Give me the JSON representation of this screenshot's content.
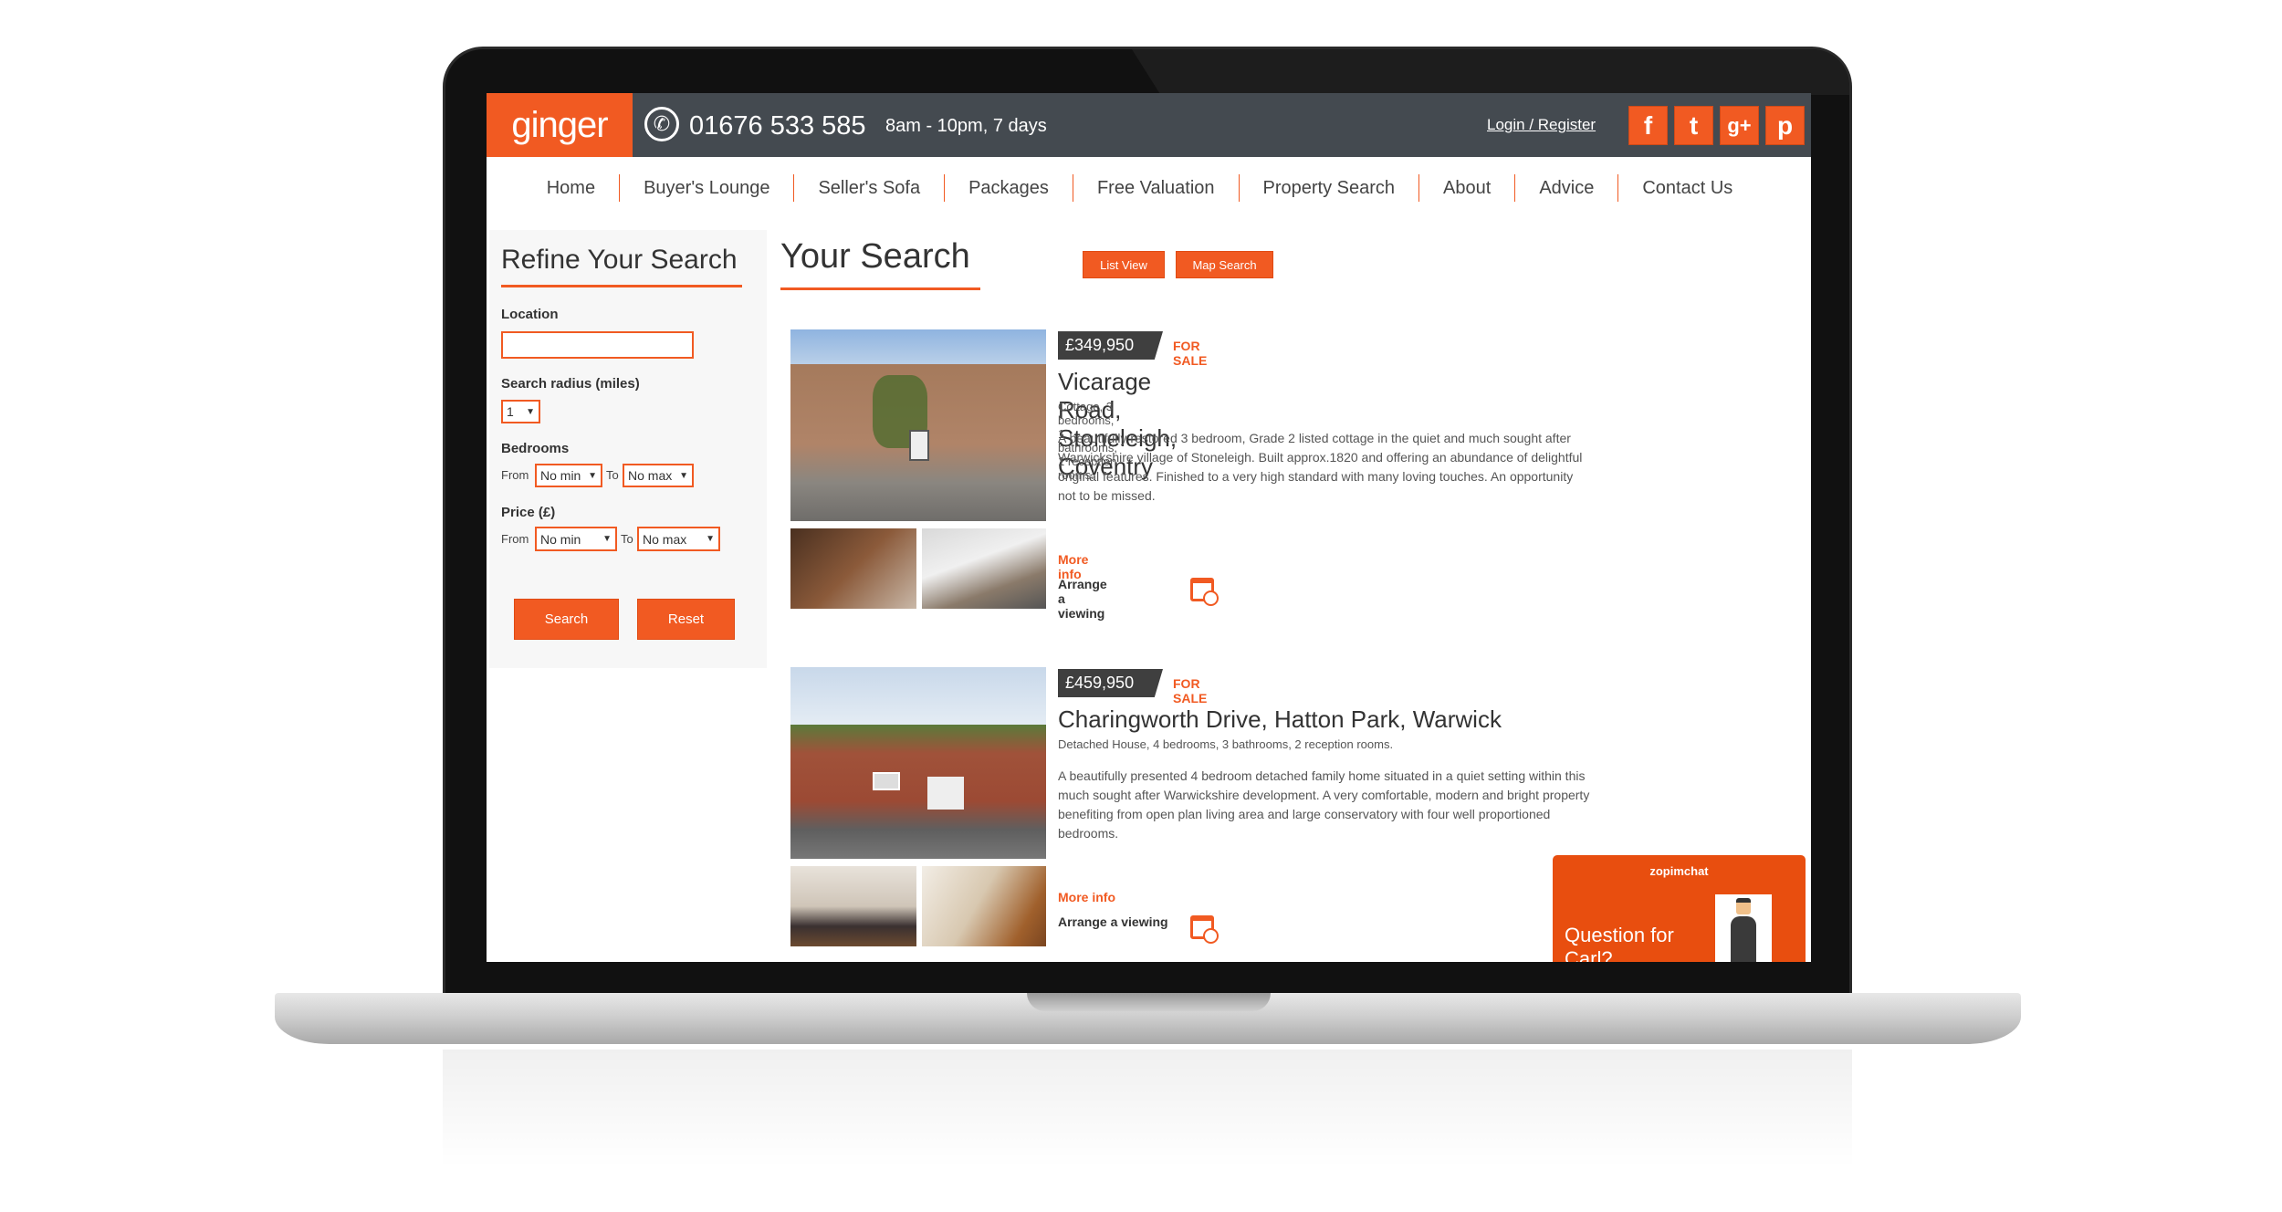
{
  "colors": {
    "accent": "#f15a22",
    "header_bg": "#444a50",
    "price_tag": "#3f3f3f",
    "chat": "#e84e0f"
  },
  "header": {
    "logo": "ginger",
    "phone_icon": "phone-icon",
    "phone": "01676 533 585",
    "hours": "8am - 10pm, 7 days",
    "login": "Login / Register",
    "social": [
      {
        "icon": "facebook-icon",
        "glyph": "f"
      },
      {
        "icon": "twitter-icon",
        "glyph": "t"
      },
      {
        "icon": "google-plus-icon",
        "glyph": "g+"
      },
      {
        "icon": "pinterest-icon",
        "glyph": "p"
      }
    ]
  },
  "nav": [
    "Home",
    "Buyer's Lounge",
    "Seller's Sofa",
    "Packages",
    "Free Valuation",
    "Property Search",
    "About",
    "Advice",
    "Contact Us"
  ],
  "sidebar": {
    "title": "Refine Your Search",
    "location_label": "Location",
    "location_value": "",
    "radius_label": "Search radius (miles)",
    "radius_value": "1",
    "bedrooms_label": "Bedrooms",
    "from": "From",
    "to": "To",
    "bed_min": "No min",
    "bed_max": "No max",
    "price_label": "Price (£)",
    "price_min": "No min",
    "price_max": "No max",
    "search": "Search",
    "reset": "Reset"
  },
  "main": {
    "title": "Your Search",
    "list_view": "List View",
    "map_search": "Map Search"
  },
  "listings": [
    {
      "price": "£349,950",
      "status": "FOR SALE",
      "title": "Vicarage Road, Stoneleigh, Coventry",
      "summary": "Cottage, 3 bedrooms, 1 bathrooms, 1 reception rooms.",
      "description": "A beautifully restored 3 bedroom, Grade 2 listed cottage in the quiet and much sought after Warwickshire village of Stoneleigh. Built approx.1820 and offering an abundance of delightful original features. Finished to a very high standard with many loving touches. An opportunity not to be missed.",
      "more": "More info",
      "arrange": "Arrange a viewing"
    },
    {
      "price": "£459,950",
      "status": "FOR SALE",
      "title": "Charingworth Drive, Hatton Park, Warwick",
      "summary": "Detached House, 4 bedrooms, 3 bathrooms, 2 reception rooms.",
      "description": "A beautifully presented 4 bedroom detached family home situated in a quiet setting within this much sought after Warwickshire development. A very comfortable, modern and bright property benefiting from open plan living area and large conservatory with four well proportioned bedrooms.",
      "more": "More info",
      "arrange": "Arrange a viewing"
    }
  ],
  "chat": {
    "brand": "zopimchat",
    "prompt": "Question for Carl?"
  }
}
